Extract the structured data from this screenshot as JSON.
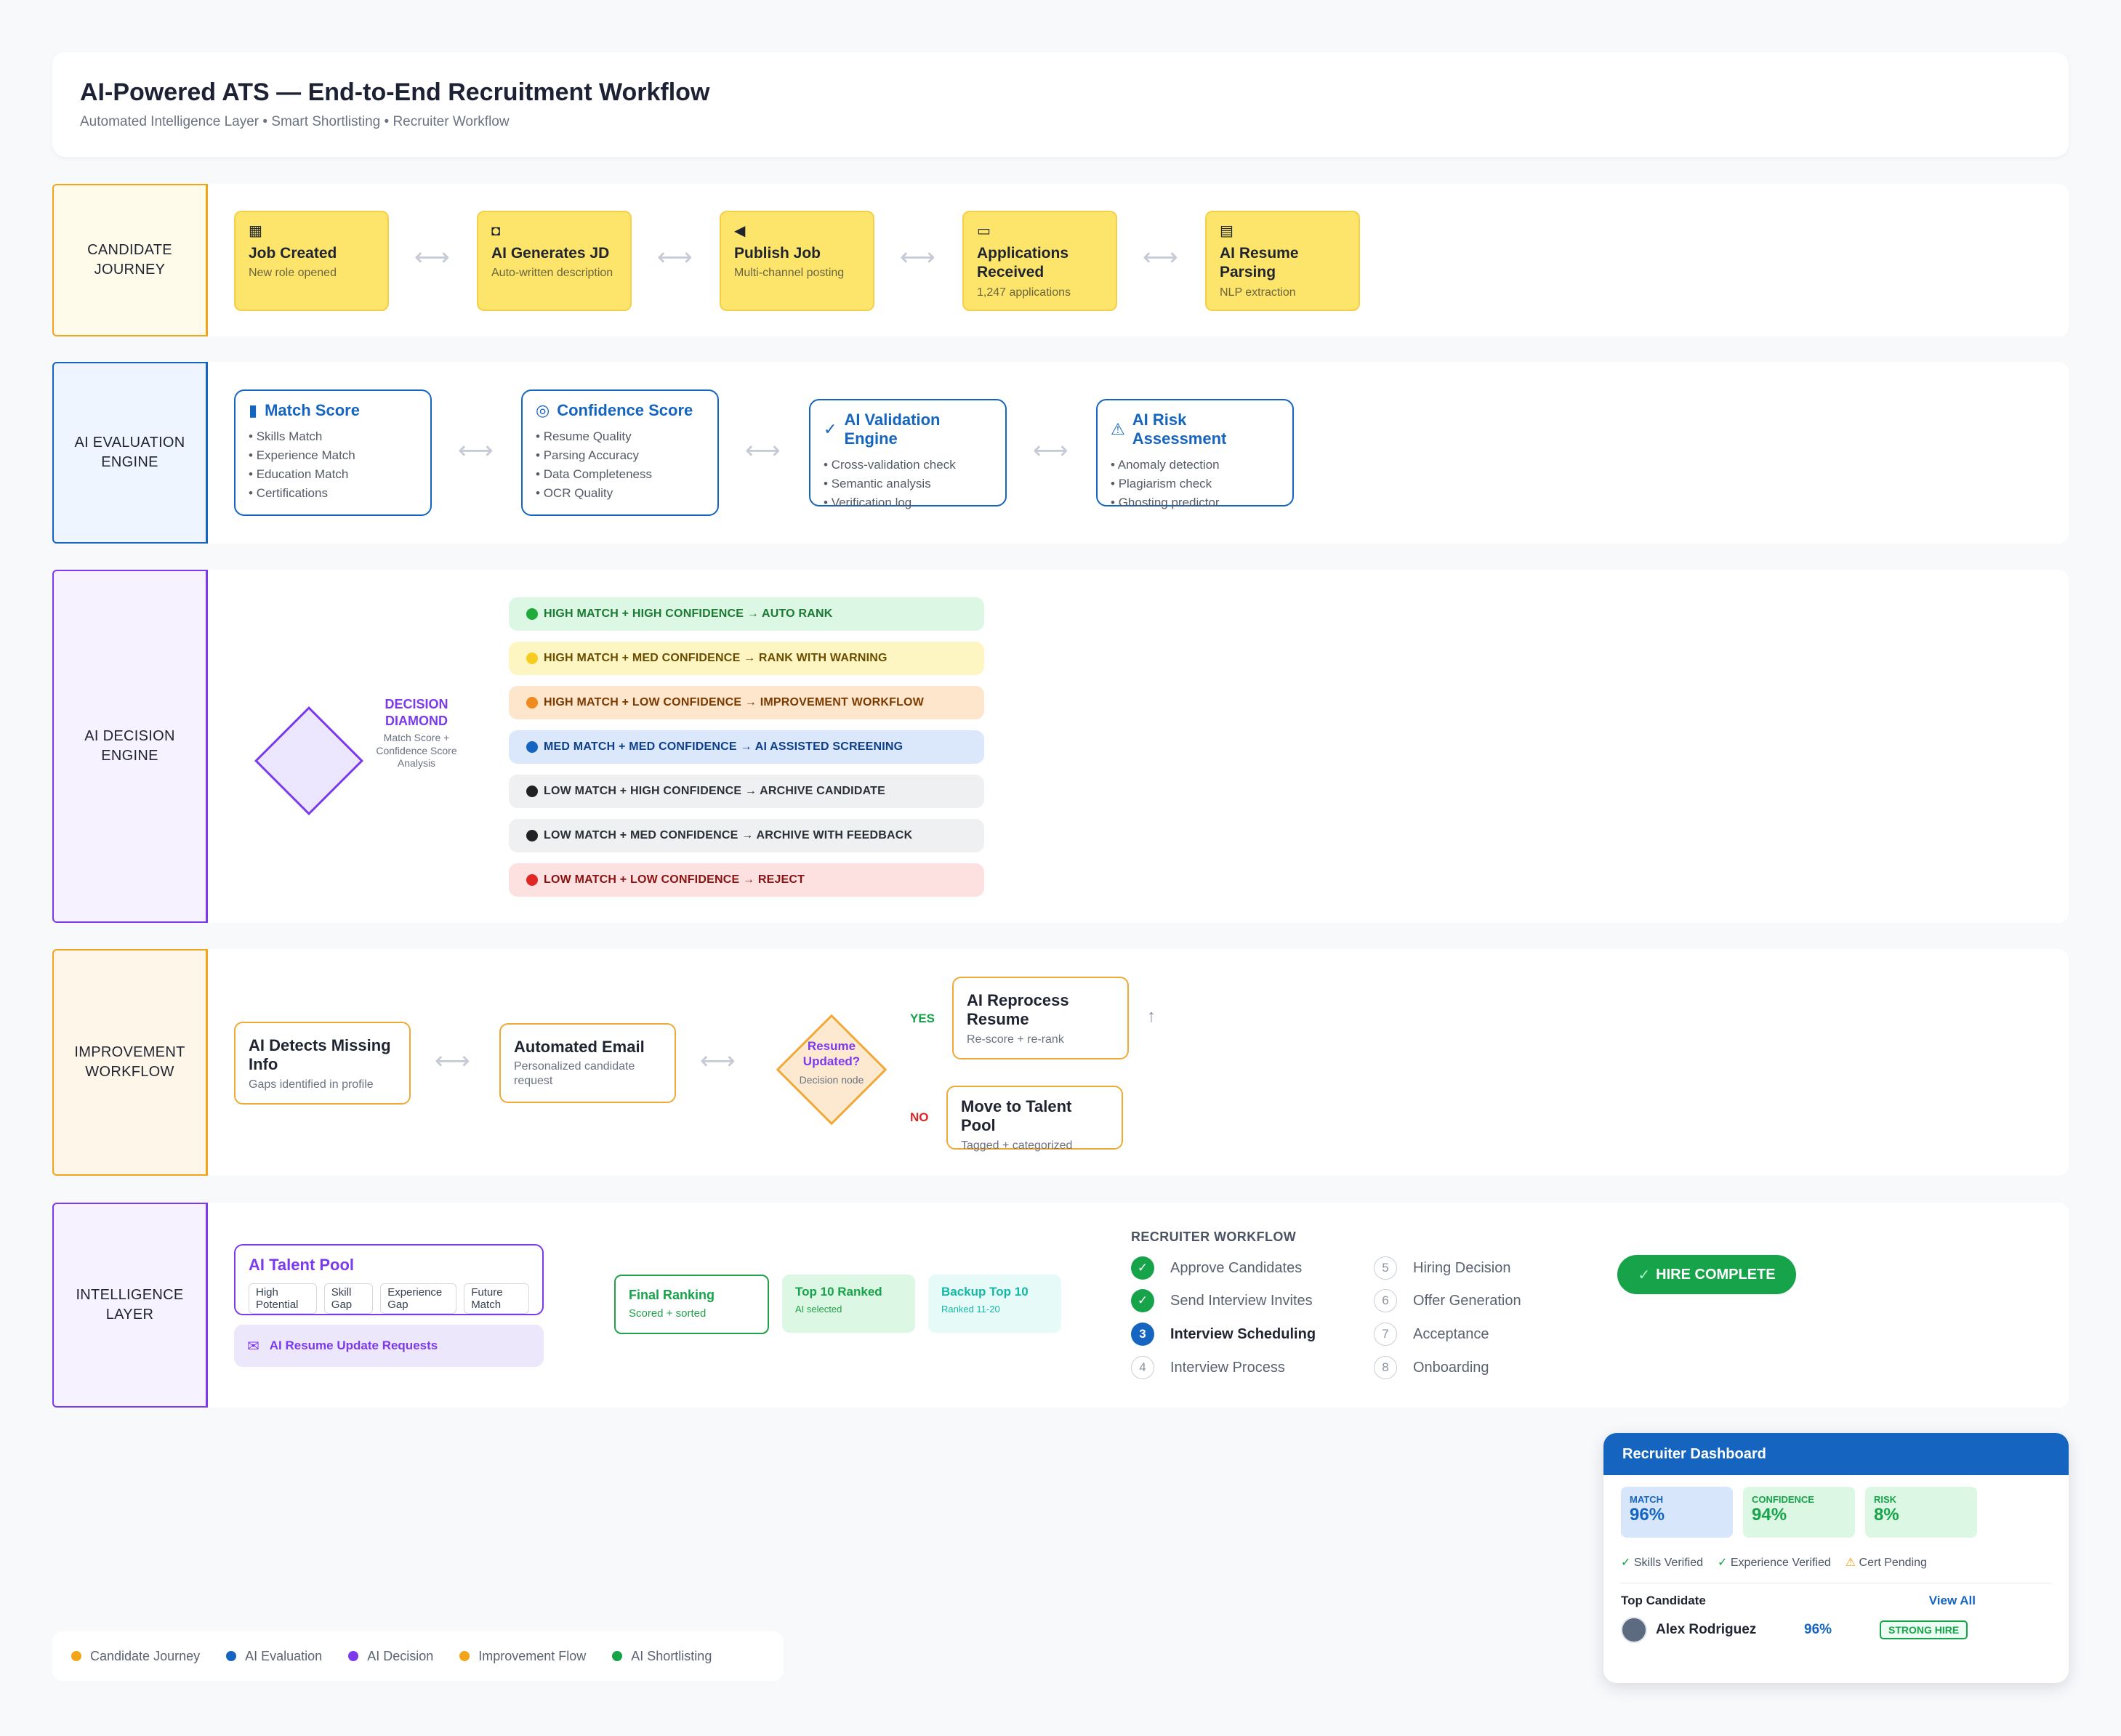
{
  "header": {
    "title": "AI-Powered ATS — End-to-End Recruitment Workflow",
    "subtitle": "Automated Intelligence Layer • Smart Shortlisting • Recruiter Workflow"
  },
  "lanes": {
    "candidate": "CANDIDATE JOURNEY",
    "evaluation": "AI EVALUATION ENGINE",
    "decision": "AI DECISION ENGINE",
    "improvement": "IMPROVEMENT WORKFLOW",
    "intelligence": "INTELLIGENCE LAYER"
  },
  "journey": [
    {
      "title": "Job Created",
      "sub": "New role opened",
      "icon": "building-icon"
    },
    {
      "title": "AI Generates JD",
      "sub": "Auto-written description",
      "icon": "robot-icon"
    },
    {
      "title": "Publish Job",
      "sub": "Multi-channel posting",
      "icon": "megaphone-icon"
    },
    {
      "title": "Applications Received",
      "sub": "1,247 applications",
      "icon": "inbox-icon"
    },
    {
      "title": "AI Resume Parsing",
      "sub": "NLP extraction",
      "icon": "document-icon"
    }
  ],
  "evaluation": [
    {
      "title": "Match Score",
      "icon": "bar-chart-icon",
      "items": [
        "Skills Match",
        "Experience Match",
        "Education Match",
        "Certifications"
      ]
    },
    {
      "title": "Confidence Score",
      "icon": "target-icon",
      "items": [
        "Resume Quality",
        "Parsing Accuracy",
        "Data Completeness",
        "OCR Quality"
      ]
    },
    {
      "title": "AI Validation Engine",
      "icon": "check-circle-icon",
      "items": [
        "Cross-validation check",
        "Semantic analysis",
        "Verification log"
      ]
    },
    {
      "title": "AI Risk Assessment",
      "icon": "warning-icon",
      "items": [
        "Anomaly detection",
        "Plagiarism check",
        "Ghosting predictor"
      ]
    }
  ],
  "decision": {
    "diamond_title": "DECISION DIAMOND",
    "diamond_sub": "Match Score + Confidence Score Analysis",
    "rules": [
      {
        "text": "HIGH MATCH + HIGH CONFIDENCE → AUTO RANK",
        "color": "#1faa3a",
        "bg": "#dcf7e3",
        "fg": "#1a7a33"
      },
      {
        "text": "HIGH MATCH + MED CONFIDENCE → RANK WITH WARNING",
        "color": "#f5cc1f",
        "bg": "#fdf6c2",
        "fg": "#6b4d00"
      },
      {
        "text": "HIGH MATCH + LOW CONFIDENCE → IMPROVEMENT WORKFLOW",
        "color": "#f08a1c",
        "bg": "#fde6cc",
        "fg": "#7a3a00"
      },
      {
        "text": "MED MATCH + MED CONFIDENCE → AI ASSISTED SCREENING",
        "color": "#1565c0",
        "bg": "#dbe8fb",
        "fg": "#0d3f8a"
      },
      {
        "text": "LOW MATCH + HIGH CONFIDENCE → ARCHIVE CANDIDATE",
        "color": "#222222",
        "bg": "#eff0f2",
        "fg": "#2b2f38"
      },
      {
        "text": "LOW MATCH + MED CONFIDENCE → ARCHIVE WITH FEEDBACK",
        "color": "#222222",
        "bg": "#eff0f2",
        "fg": "#2b2f38"
      },
      {
        "text": "LOW MATCH + LOW CONFIDENCE → REJECT",
        "color": "#e02626",
        "bg": "#fde0e0",
        "fg": "#8a1212"
      }
    ]
  },
  "improvement": {
    "detect": {
      "title": "AI Detects Missing Info",
      "sub": "Gaps identified in profile"
    },
    "email": {
      "title": "Automated Email",
      "sub": "Personalized candidate request"
    },
    "diamond": {
      "title": "Resume Updated?",
      "sub": "Decision node"
    },
    "yes": "YES",
    "no": "NO",
    "reprocess": {
      "title": "AI Reprocess Resume",
      "sub": "Re-score + re-rank"
    },
    "talent": {
      "title": "Move to Talent Pool",
      "sub": "Tagged + categorized"
    }
  },
  "intelligence": {
    "pool_title": "AI Talent Pool",
    "tags": [
      "High Potential",
      "Skill Gap",
      "Experience Gap",
      "Future Match"
    ],
    "update_requests": "AI Resume Update Requests",
    "final": {
      "title": "Final Ranking",
      "sub": "Scored + sorted"
    },
    "top10": {
      "title": "Top 10 Ranked",
      "sub": "AI selected"
    },
    "backup": {
      "title": "Backup Top 10",
      "sub": "Ranked 11-20"
    }
  },
  "recruiter": {
    "heading": "RECRUITER WORKFLOW",
    "steps_left": [
      {
        "num": "",
        "label": "Approve Candidates",
        "state": "done"
      },
      {
        "num": "",
        "label": "Send Interview Invites",
        "state": "done"
      },
      {
        "num": "3",
        "label": "Interview Scheduling",
        "state": "current"
      },
      {
        "num": "4",
        "label": "Interview Process",
        "state": "pending"
      }
    ],
    "steps_right": [
      {
        "num": "5",
        "label": "Hiring Decision"
      },
      {
        "num": "6",
        "label": "Offer Generation"
      },
      {
        "num": "7",
        "label": "Acceptance"
      },
      {
        "num": "8",
        "label": "Onboarding"
      }
    ],
    "hire_button": "HIRE COMPLETE"
  },
  "dashboard": {
    "title": "Recruiter Dashboard",
    "metrics": [
      {
        "label": "MATCH",
        "value": "96%"
      },
      {
        "label": "CONFIDENCE",
        "value": "94%"
      },
      {
        "label": "RISK",
        "value": "8%"
      }
    ],
    "checks": [
      "Skills Verified",
      "Experience Verified",
      "Cert Pending"
    ],
    "top_label": "Top Candidate",
    "view_all": "View All",
    "candidate_name": "Alex Rodriguez",
    "candidate_score": "96%",
    "candidate_badge": "STRONG HIRE"
  },
  "legend": [
    "Candidate Journey",
    "AI Evaluation",
    "AI Decision",
    "Improvement Flow",
    "AI Shortlisting"
  ],
  "colors": {
    "candidate": "#f2a51a",
    "evaluation": "#1565c0",
    "decision": "#7c3aed",
    "improvement": "#f2a51a",
    "shortlisting": "#16a34a"
  }
}
